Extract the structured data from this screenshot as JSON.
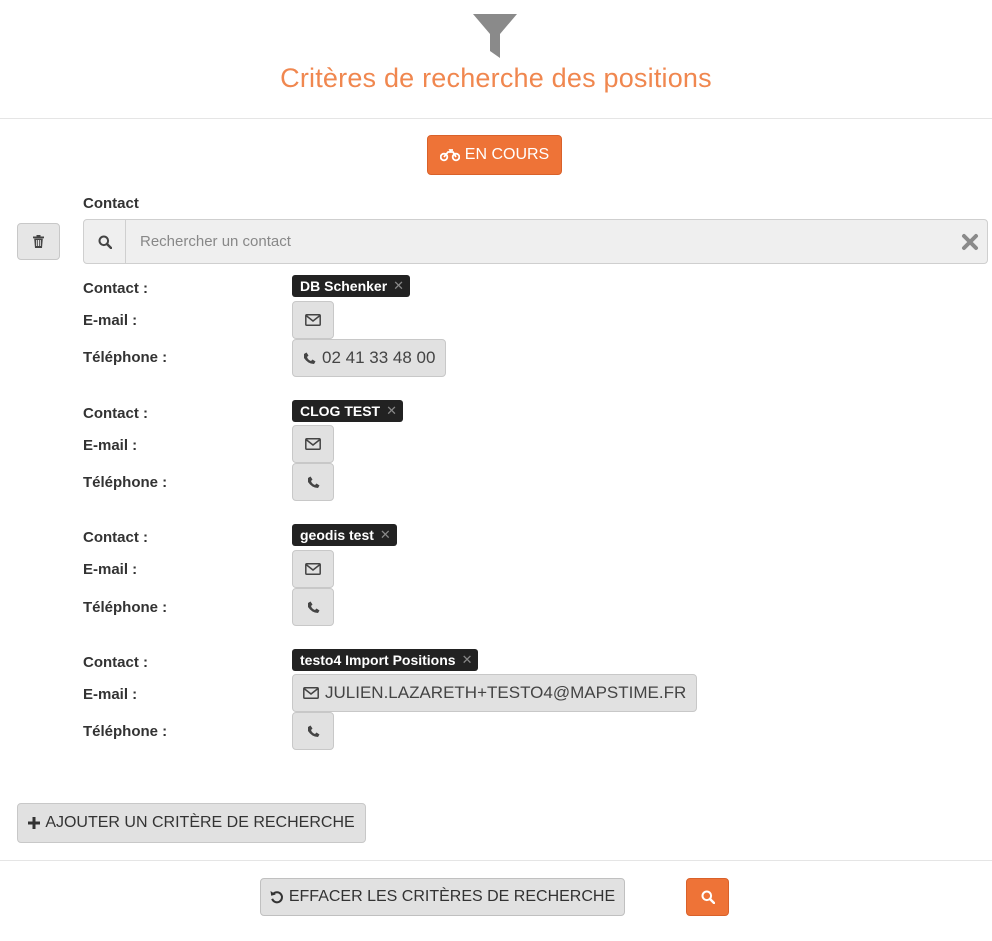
{
  "header": {
    "title": "Critères de recherche des positions"
  },
  "status_button": {
    "label": "EN COURS",
    "icon": "motorcycle-icon"
  },
  "contact_field": {
    "label": "Contact",
    "search_placeholder": "Rechercher un contact",
    "search_value": ""
  },
  "labels": {
    "contact": "Contact :",
    "email": "E-mail :",
    "phone": "Téléphone :"
  },
  "contacts": [
    {
      "name": "DB Schenker",
      "email": "",
      "phone": "02 41 33 48 00"
    },
    {
      "name": "CLOG TEST",
      "email": "",
      "phone": ""
    },
    {
      "name": "geodis test",
      "email": "",
      "phone": ""
    },
    {
      "name": "testo4 Import Positions",
      "email": "JULIEN.LAZARETH+TESTO4@MAPSTIME.FR",
      "phone": ""
    }
  ],
  "actions": {
    "add_criterion": "AJOUTER UN CRITÈRE DE RECHERCHE",
    "clear_criteria": "EFFACER LES CRITÈRES DE RECHERCHE"
  },
  "colors": {
    "accent": "#ee7337",
    "title": "#f0874f",
    "tag_bg": "#222222",
    "button_gray": "#e1e1e1"
  }
}
